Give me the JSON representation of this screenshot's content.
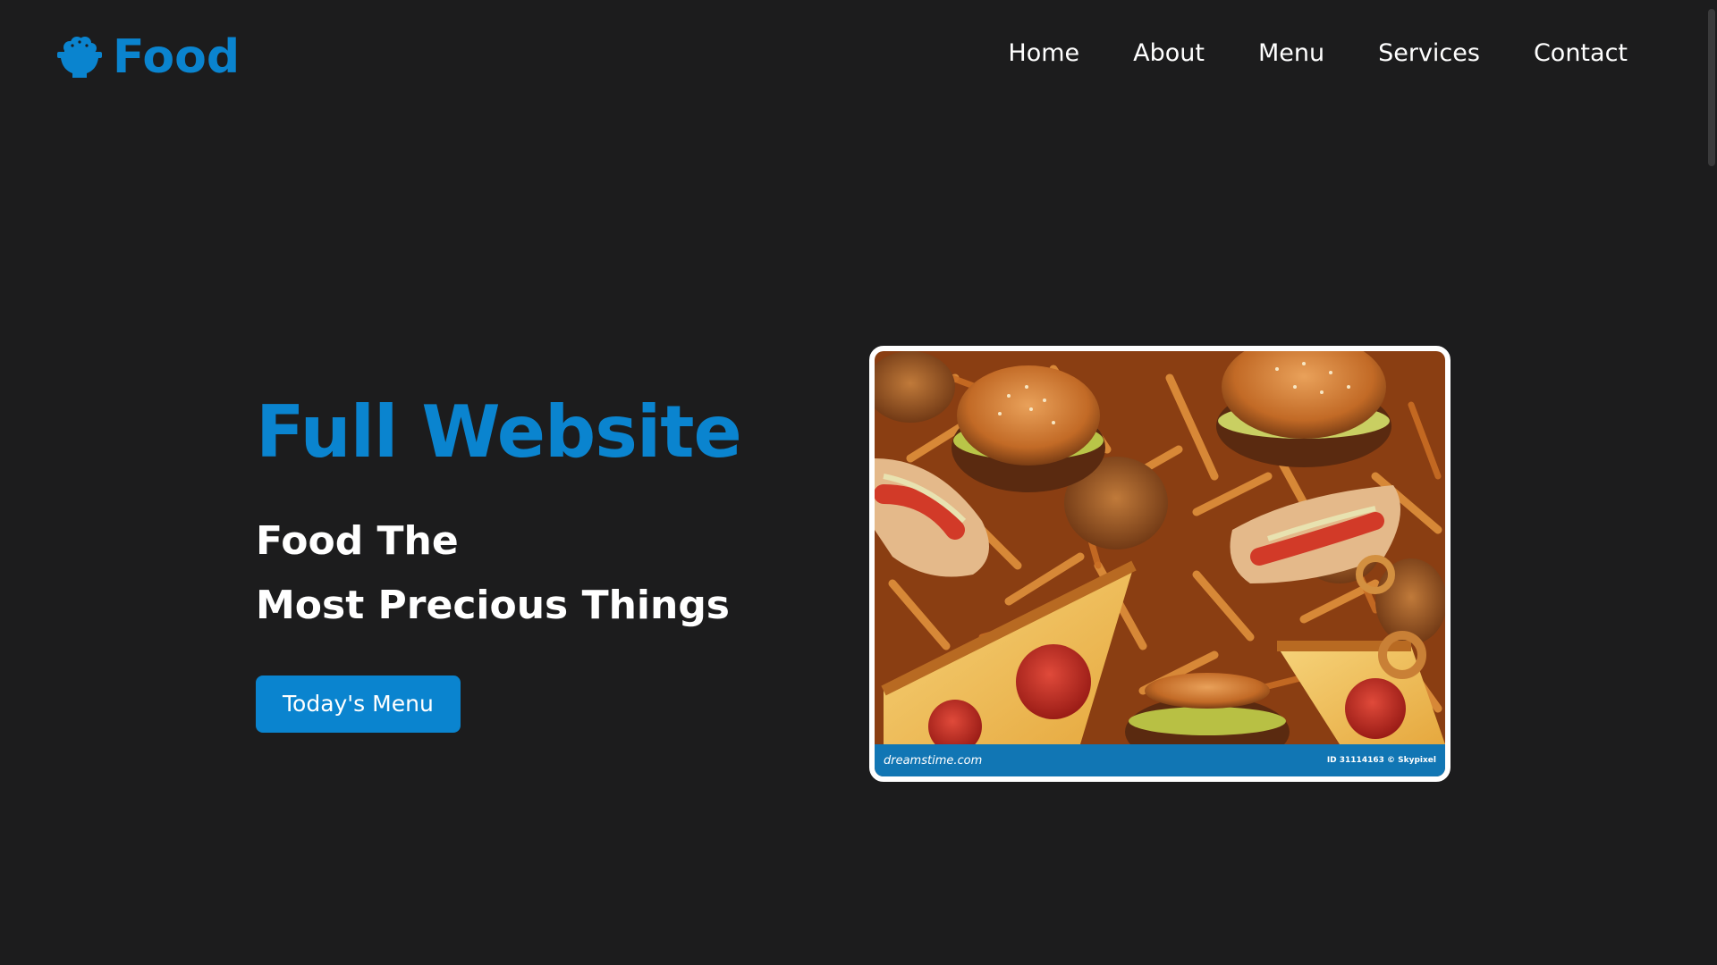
{
  "brand": {
    "name": "Food",
    "icon": "rice-bowl-icon",
    "color": "#0a84cf"
  },
  "nav": {
    "items": [
      {
        "label": "Home"
      },
      {
        "label": "About"
      },
      {
        "label": "Menu"
      },
      {
        "label": "Services"
      },
      {
        "label": "Contact"
      }
    ]
  },
  "hero": {
    "title": "Full Website",
    "subtitle_line1": "Food The",
    "subtitle_line2": "Most Precious Things",
    "cta_label": "Today's Menu",
    "image": {
      "subject": "fast-food-collage-image",
      "watermark_left": "dreamstime.com",
      "watermark_right": "ID 31114163 © Skypixel"
    }
  },
  "colors": {
    "background": "#1c1c1d",
    "accent": "#0a84cf",
    "text": "#ffffff"
  }
}
